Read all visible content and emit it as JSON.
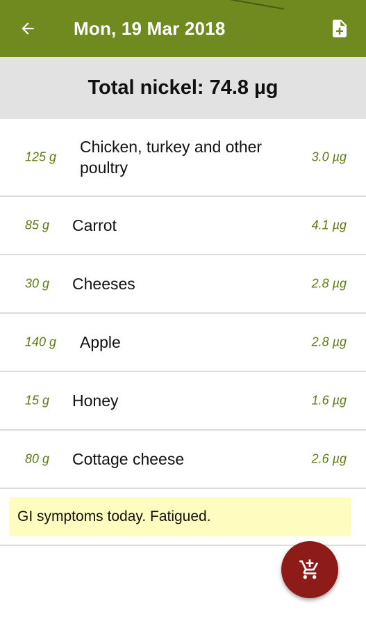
{
  "colors": {
    "appbar": "#6f8a1f",
    "accent_text": "#5c7a14",
    "banner": "#e2e2e2",
    "note_bg": "#fffcbf",
    "fab": "#8d1b17"
  },
  "appbar": {
    "title": "Mon, 19 Mar 2018",
    "back_icon": "arrow-back-icon",
    "export_icon": "add-document-icon"
  },
  "summary": {
    "total": "Total nickel: 74.8 µg"
  },
  "foods": [
    {
      "qty": "125 g",
      "name": "Chicken, turkey and other poultry",
      "nickel": "3.0 µg"
    },
    {
      "qty": "85 g",
      "name": "Carrot",
      "nickel": "4.1 µg"
    },
    {
      "qty": "30 g",
      "name": "Cheeses",
      "nickel": "2.8 µg"
    },
    {
      "qty": "140 g",
      "name": "Apple",
      "nickel": "2.8 µg"
    },
    {
      "qty": "15 g",
      "name": "Honey",
      "nickel": "1.6 µg"
    },
    {
      "qty": "80 g",
      "name": "Cottage cheese",
      "nickel": "2.6 µg"
    }
  ],
  "note": "GI symptoms today. Fatigued.",
  "fab": {
    "icon": "add-to-cart-icon"
  }
}
